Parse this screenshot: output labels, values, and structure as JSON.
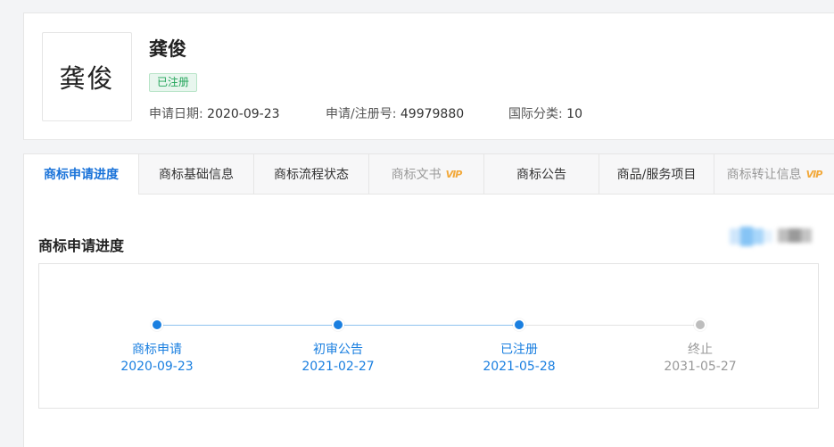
{
  "trademark": {
    "logo_text": "龚俊",
    "name": "龚俊",
    "status": "已注册",
    "apply_date_label": "申请日期:",
    "apply_date": "2020-09-23",
    "reg_no_label": "申请/注册号:",
    "reg_no": "49979880",
    "class_label": "国际分类:",
    "class_value": "10"
  },
  "tabs": [
    {
      "label": "商标申请进度",
      "active": true,
      "vip": false
    },
    {
      "label": "商标基础信息",
      "active": false,
      "vip": false
    },
    {
      "label": "商标流程状态",
      "active": false,
      "vip": false
    },
    {
      "label": "商标文书",
      "active": false,
      "vip": true
    },
    {
      "label": "商标公告",
      "active": false,
      "vip": false
    },
    {
      "label": "商品/服务项目",
      "active": false,
      "vip": false
    },
    {
      "label": "商标转让信息",
      "active": false,
      "vip": true
    }
  ],
  "vip_badge": "VIP",
  "section": {
    "title": "商标申请进度"
  },
  "progress": {
    "steps": [
      {
        "label": "商标申请",
        "date": "2020-09-23",
        "state": "done"
      },
      {
        "label": "初审公告",
        "date": "2021-02-27",
        "state": "done"
      },
      {
        "label": "已注册",
        "date": "2021-05-28",
        "state": "done"
      },
      {
        "label": "终止",
        "date": "2031-05-27",
        "state": "pending"
      }
    ]
  },
  "colors": {
    "accent": "#1a7fe0",
    "done": "#1a7fe0",
    "pending": "#bdbdbd",
    "pending_text": "#999999",
    "status_green": "#23a55a"
  }
}
